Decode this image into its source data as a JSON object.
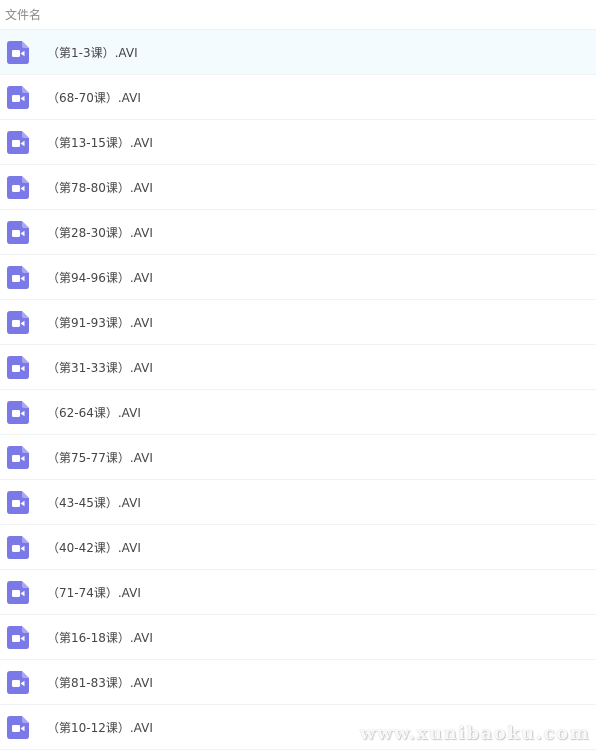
{
  "header": {
    "column_label": "文件名"
  },
  "files": [
    {
      "name": "（第1-3课）.AVI",
      "icon": "video-file-icon",
      "selected": true
    },
    {
      "name": "（68-70课）.AVI",
      "icon": "video-file-icon"
    },
    {
      "name": "（第13-15课）.AVI",
      "icon": "video-file-icon"
    },
    {
      "name": "（第78-80课）.AVI",
      "icon": "video-file-icon"
    },
    {
      "name": "（第28-30课）.AVI",
      "icon": "video-file-icon"
    },
    {
      "name": "（第94-96课）.AVI",
      "icon": "video-file-icon"
    },
    {
      "name": "（第91-93课）.AVI",
      "icon": "video-file-icon"
    },
    {
      "name": "（第31-33课）.AVI",
      "icon": "video-file-icon"
    },
    {
      "name": "（62-64课）.AVI",
      "icon": "video-file-icon"
    },
    {
      "name": "（第75-77课）.AVI",
      "icon": "video-file-icon"
    },
    {
      "name": "（43-45课）.AVI",
      "icon": "video-file-icon"
    },
    {
      "name": "（40-42课）.AVI",
      "icon": "video-file-icon"
    },
    {
      "name": "（71-74课）.AVI",
      "icon": "video-file-icon"
    },
    {
      "name": "（第16-18课）.AVI",
      "icon": "video-file-icon"
    },
    {
      "name": "（第81-83课）.AVI",
      "icon": "video-file-icon"
    },
    {
      "name": "（第10-12课）.AVI",
      "icon": "video-file-icon"
    }
  ],
  "watermark": {
    "text": "www.xunibaoku.com"
  },
  "colors": {
    "icon_purple": "#7b78e8",
    "selected_row_bg": "#f4fbff"
  }
}
